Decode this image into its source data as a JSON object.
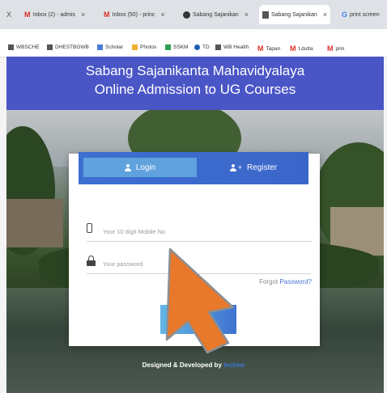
{
  "browser": {
    "tabs": [
      {
        "label": "X",
        "icon": "close-icon"
      },
      {
        "label": "Inbox (2) - admis",
        "icon": "gmail-icon"
      },
      {
        "label": "Inbox (50) - princ",
        "icon": "gmail-icon"
      },
      {
        "label": "Sabang Sajanikan",
        "icon": "globe-icon"
      },
      {
        "label": "Sabang Sajanikan",
        "icon": "document-icon",
        "active": true
      },
      {
        "label": "print screen",
        "icon": "google-icon"
      }
    ],
    "bookmarks": [
      {
        "label": "WBSCHE",
        "icon": "document-icon"
      },
      {
        "label": "DHESTBGWB",
        "icon": "document-icon"
      },
      {
        "label": "Scholar",
        "icon": "scholar-icon"
      },
      {
        "label": "Photos",
        "icon": "photos-icon"
      },
      {
        "label": "SSKM",
        "icon": "drive-icon"
      },
      {
        "label": "TD",
        "icon": "cloud-icon"
      },
      {
        "label": "WB Health",
        "icon": "document-icon"
      },
      {
        "label": "Tapan",
        "icon": "gmail-icon"
      },
      {
        "label": "t.dutta",
        "icon": "gmail-icon"
      },
      {
        "label": "prin",
        "icon": "gmail-icon"
      }
    ]
  },
  "banner": {
    "line1": "Sabang Sajanikanta Mahavidyalaya",
    "line2": "Online Admission to UG Courses"
  },
  "auth": {
    "tab_login": "Login",
    "tab_register": "Register",
    "mobile_placeholder": "Your 10 digit Mobile No",
    "password_placeholder": "Your password",
    "forgot_prefix": "Forgot ",
    "forgot_link": "Password?",
    "login_button": "Lo"
  },
  "footer": {
    "prefix": "Designed & Developed by ",
    "brand": "techno"
  },
  "colors": {
    "banner": "#4a55c6",
    "tab_bar": "#3d6fd1",
    "tab_active": "#5fa2dd",
    "link": "#4a76d6",
    "arrow": "#e8782a"
  }
}
